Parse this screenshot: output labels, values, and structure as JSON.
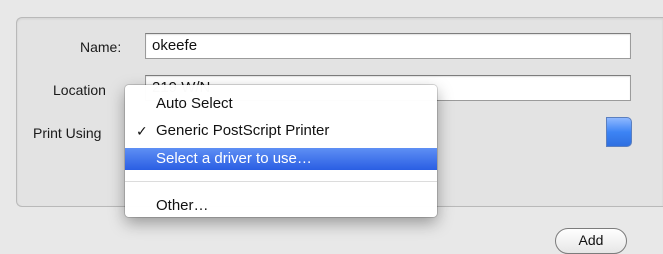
{
  "form": {
    "name_label": "Name:",
    "name_value": "okeefe",
    "location_label": "Location",
    "location_value": "219 W/N",
    "print_using_label": "Print Using"
  },
  "menu": {
    "items": [
      {
        "label": "Auto Select",
        "checked": false
      },
      {
        "label": "Generic PostScript Printer",
        "checked": true,
        "check_mark": "✓"
      },
      {
        "label": "Select a driver to use…",
        "highlighted": true
      },
      {
        "label": "Other…"
      }
    ]
  },
  "buttons": {
    "add_label": "Add"
  },
  "colors": {
    "selection": "#2f63e6",
    "panel": "#e3e3e3"
  }
}
